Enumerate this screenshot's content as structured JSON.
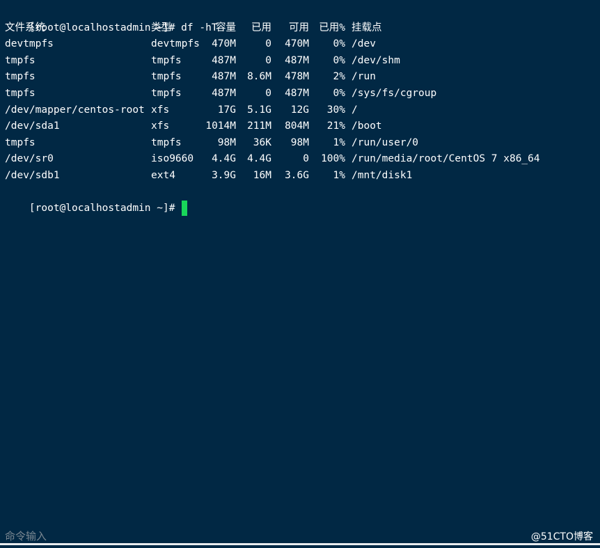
{
  "terminal": {
    "command_prompt": "[root@localhostadmin ~]# df -hT",
    "final_prompt": "[root@localhostadmin ~]#",
    "header": {
      "filesystem": "文件系统",
      "type": "类型",
      "size": "容量",
      "used": "已用",
      "avail": "可用",
      "use_percent": "已用%",
      "mounted_on": "挂载点"
    },
    "rows": [
      {
        "filesystem": "devtmpfs",
        "type": "devtmpfs",
        "size": "470M",
        "used": "0",
        "avail": "470M",
        "use_percent": "0%",
        "mounted_on": "/dev"
      },
      {
        "filesystem": "tmpfs",
        "type": "tmpfs",
        "size": "487M",
        "used": "0",
        "avail": "487M",
        "use_percent": "0%",
        "mounted_on": "/dev/shm"
      },
      {
        "filesystem": "tmpfs",
        "type": "tmpfs",
        "size": "487M",
        "used": "8.6M",
        "avail": "478M",
        "use_percent": "2%",
        "mounted_on": "/run"
      },
      {
        "filesystem": "tmpfs",
        "type": "tmpfs",
        "size": "487M",
        "used": "0",
        "avail": "487M",
        "use_percent": "0%",
        "mounted_on": "/sys/fs/cgroup"
      },
      {
        "filesystem": "/dev/mapper/centos-root",
        "type": "xfs",
        "size": "17G",
        "used": "5.1G",
        "avail": "12G",
        "use_percent": "30%",
        "mounted_on": "/"
      },
      {
        "filesystem": "/dev/sda1",
        "type": "xfs",
        "size": "1014M",
        "used": "211M",
        "avail": "804M",
        "use_percent": "21%",
        "mounted_on": "/boot"
      },
      {
        "filesystem": "tmpfs",
        "type": "tmpfs",
        "size": "98M",
        "used": "36K",
        "avail": "98M",
        "use_percent": "1%",
        "mounted_on": "/run/user/0"
      },
      {
        "filesystem": "/dev/sr0",
        "type": "iso9660",
        "size": "4.4G",
        "used": "4.4G",
        "avail": "0",
        "use_percent": "100%",
        "mounted_on": "/run/media/root/CentOS 7 x86_64"
      },
      {
        "filesystem": "/dev/sdb1",
        "type": "ext4",
        "size": "3.9G",
        "used": "16M",
        "avail": "3.6G",
        "use_percent": "1%",
        "mounted_on": "/mnt/disk1"
      }
    ]
  },
  "status_bar": {
    "input_placeholder": "命令输入",
    "watermark": "@51CTO博客"
  },
  "colors": {
    "background": "#012844",
    "text": "#ffffff",
    "cursor": "#18d65a",
    "status_text": "#7a8791"
  }
}
